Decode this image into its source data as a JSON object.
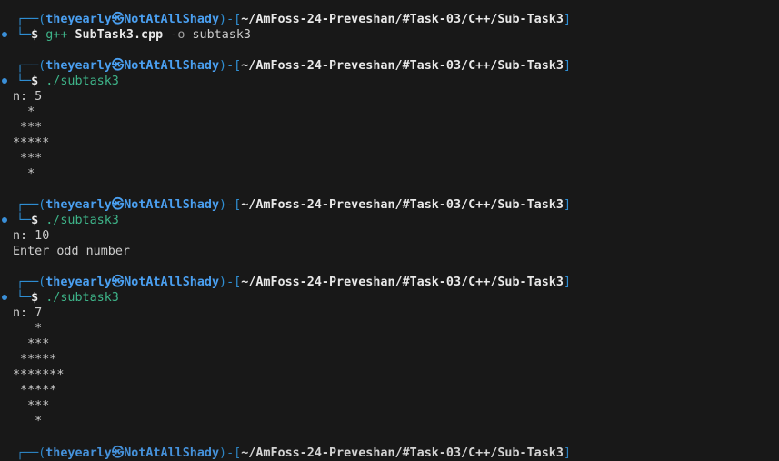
{
  "prompt": {
    "box_top": "┌──(",
    "user": "theyearly",
    "at_icon": "㉿",
    "host": "NotAtAllShady",
    "mid": ")-[",
    "path": "~/AmFoss-24-Preveshan/#Task-03/C++/Sub-Task3",
    "close": "]",
    "box_bottom": "└─",
    "dollar": "$"
  },
  "commands": [
    {
      "parts": [
        "g++",
        "SubTask3.cpp",
        "-o",
        "subtask3"
      ]
    },
    {
      "text": "./subtask3"
    },
    {
      "text": "./subtask3"
    },
    {
      "text": "./subtask3"
    }
  ],
  "outputs": [
    [
      "n: 5",
      "  *",
      " ***",
      "*****",
      " ***",
      "  *"
    ],
    [
      "n: 10",
      "Enter odd number"
    ],
    [
      "n: 7",
      "   *",
      "  ***",
      " *****",
      "*******",
      " *****",
      "  ***",
      "   *"
    ]
  ],
  "colors": {
    "background": "#181818",
    "accent_blue": "#2f8fd4",
    "command_green": "#3eb489",
    "text": "#cccccc"
  }
}
